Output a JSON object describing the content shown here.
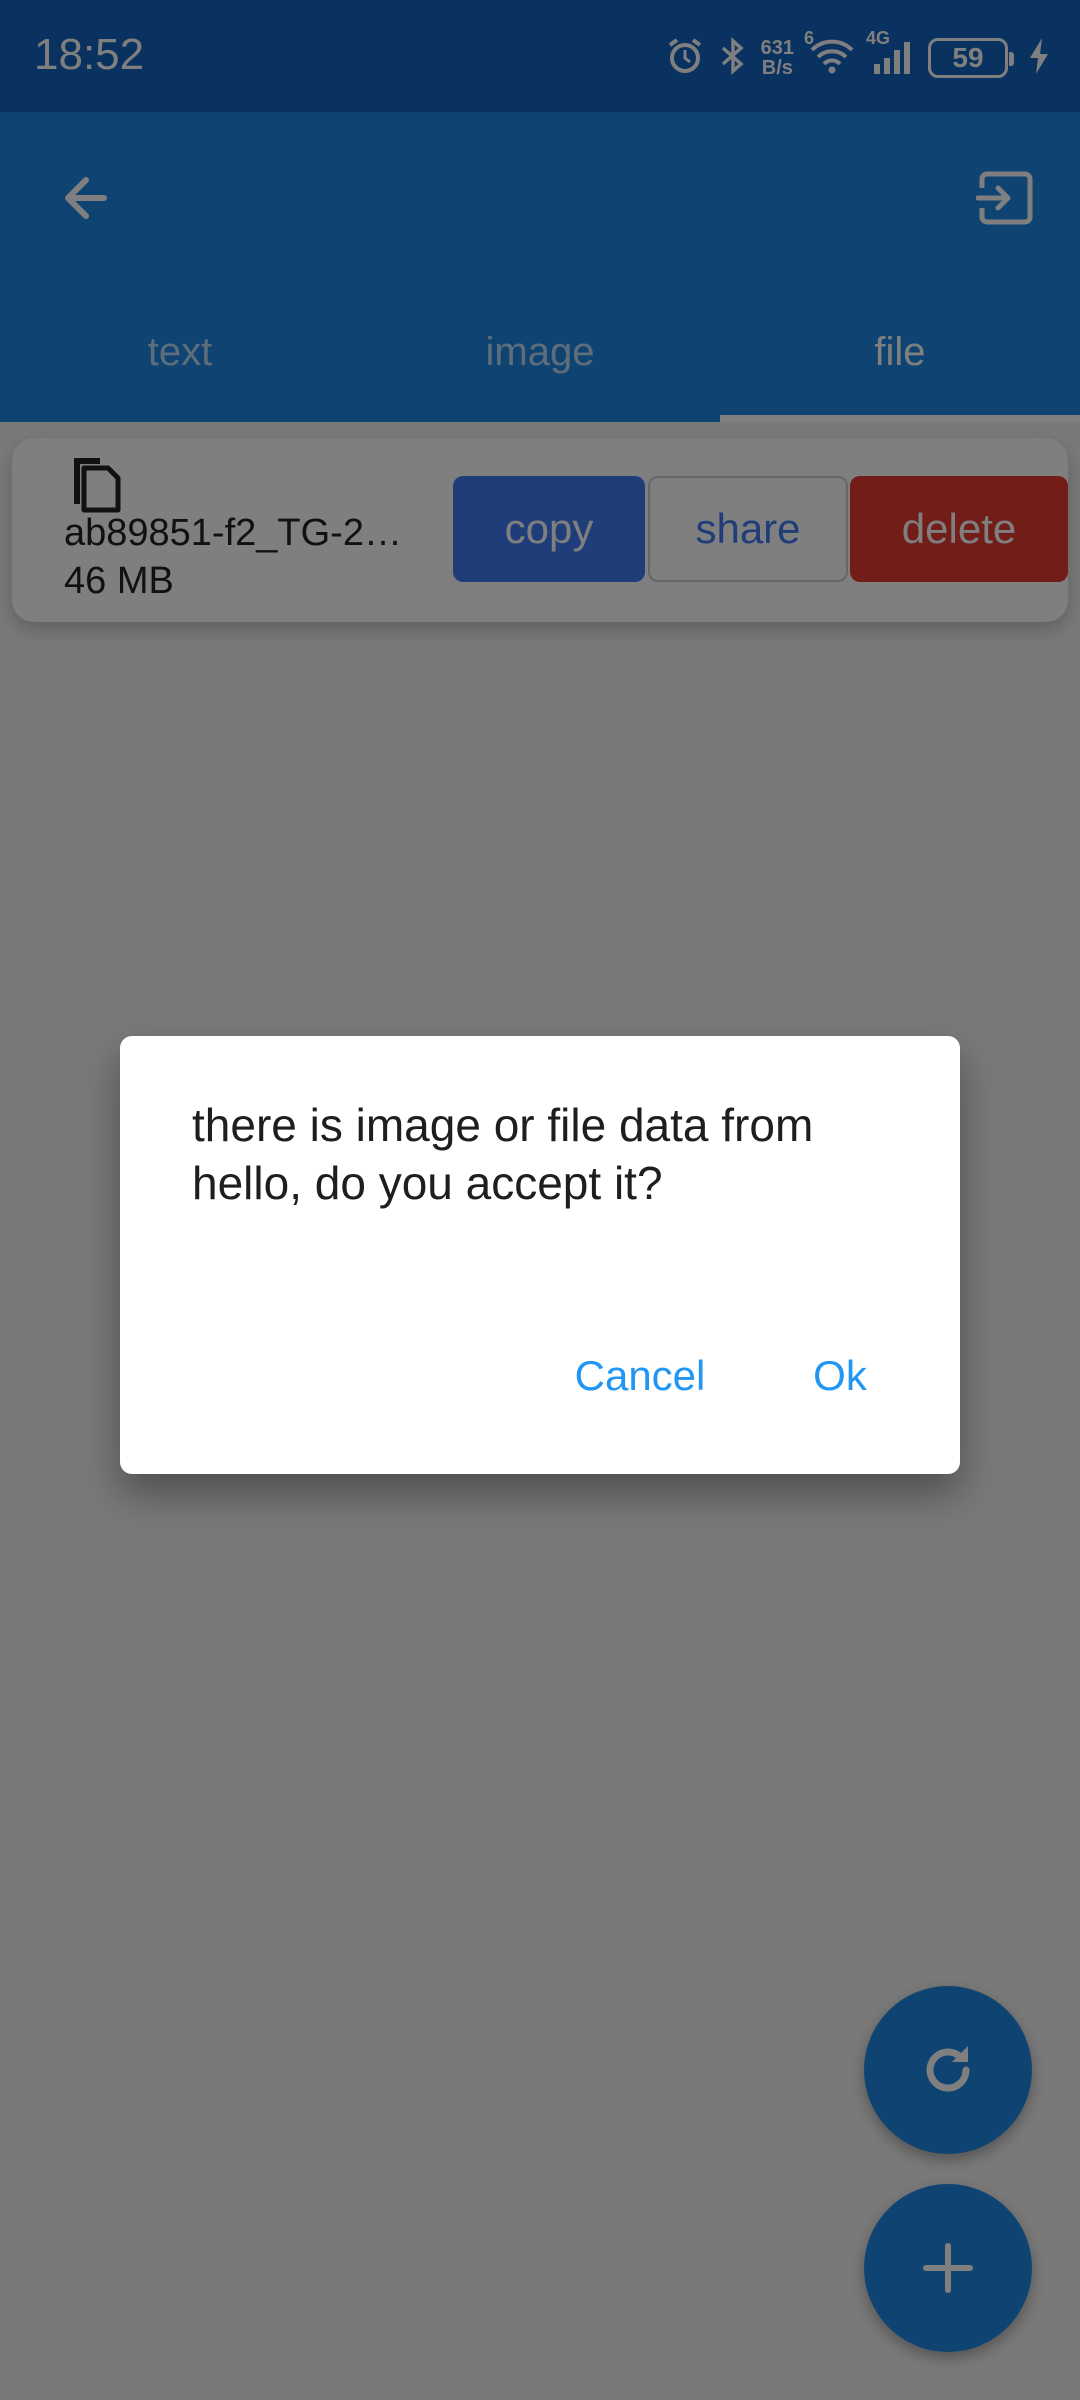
{
  "status_bar": {
    "time": "18:52",
    "net_speed_value": "631",
    "net_speed_unit": "B/s",
    "wifi_label": "6",
    "cell_label": "4G",
    "battery": "59"
  },
  "app_bar": {
    "tabs": [
      {
        "label": "text"
      },
      {
        "label": "image"
      },
      {
        "label": "file"
      }
    ],
    "active_tab": "file"
  },
  "file_item": {
    "name": "ab89851-f2_TG-2…",
    "size": "46 MB",
    "copy_label": "copy",
    "share_label": "share",
    "delete_label": "delete"
  },
  "dialog": {
    "message": "there is image or file data from hello, do you accept it?",
    "cancel_label": "Cancel",
    "ok_label": "Ok"
  },
  "colors": {
    "primary": "#1e88e5",
    "copy": "#3f7df3",
    "delete": "#e53a2e",
    "dialog_action": "#2196f3"
  },
  "icons": {
    "back": "arrow-left-icon",
    "exit": "exit-to-app-icon",
    "file": "copy-file-icon",
    "refresh": "refresh-icon",
    "add": "plus-icon"
  }
}
